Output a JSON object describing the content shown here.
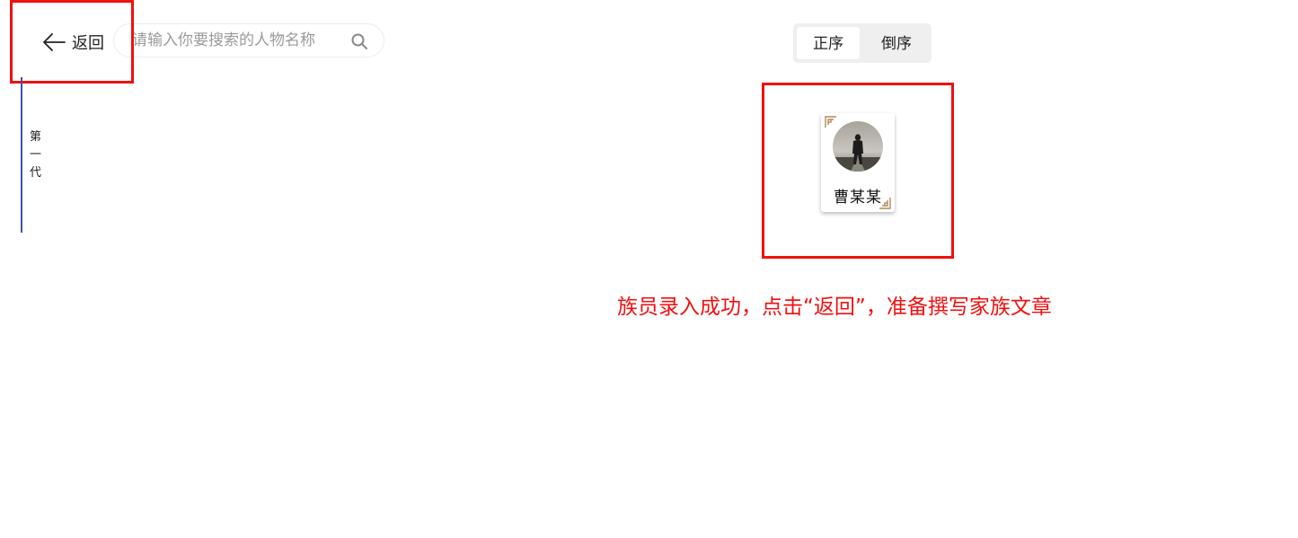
{
  "header": {
    "back_label": "返回",
    "search_placeholder": "请输入你要搜索的人物名称",
    "search_value": ""
  },
  "sort": {
    "options": [
      "正序",
      "倒序"
    ],
    "selected": "正序"
  },
  "generation": {
    "label": "第一代"
  },
  "members": [
    {
      "name": "曹某某"
    }
  ],
  "annotation": {
    "text": "族员录入成功，点击“返回”，准备撰写家族文章"
  },
  "colors": {
    "highlight": "#f01010",
    "rail": "#3f51b5",
    "toggle_bg": "#efefef",
    "corner": "#b08a5a"
  },
  "icons": {
    "back": "arrow-left-icon",
    "search": "search-icon",
    "corner": "corner-ornament-icon"
  }
}
